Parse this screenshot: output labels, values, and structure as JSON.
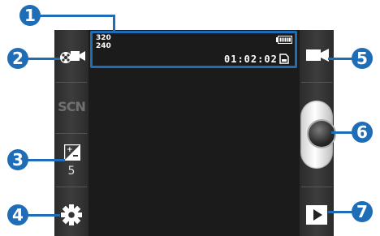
{
  "callouts": [
    "1",
    "2",
    "3",
    "4",
    "5",
    "6",
    "7"
  ],
  "status": {
    "resolution_width": "320",
    "resolution_height": "240",
    "recording_time": "01:02:02"
  },
  "left_bar": {
    "scene_label": "SCN",
    "exposure_value": "5"
  },
  "icons": {
    "recording_mode": "video-camera-effects-icon",
    "scene": "scene-mode-icon",
    "exposure": "exposure-icon",
    "settings": "gear-icon",
    "switch_mode": "video-camera-icon",
    "shutter": "record-button",
    "play": "play-icon",
    "battery": "battery-icon",
    "memory": "memory-card-icon"
  },
  "colors": {
    "callout": "#1f6db6",
    "viewfinder": "#1b1b1b",
    "bars": "#333333"
  }
}
